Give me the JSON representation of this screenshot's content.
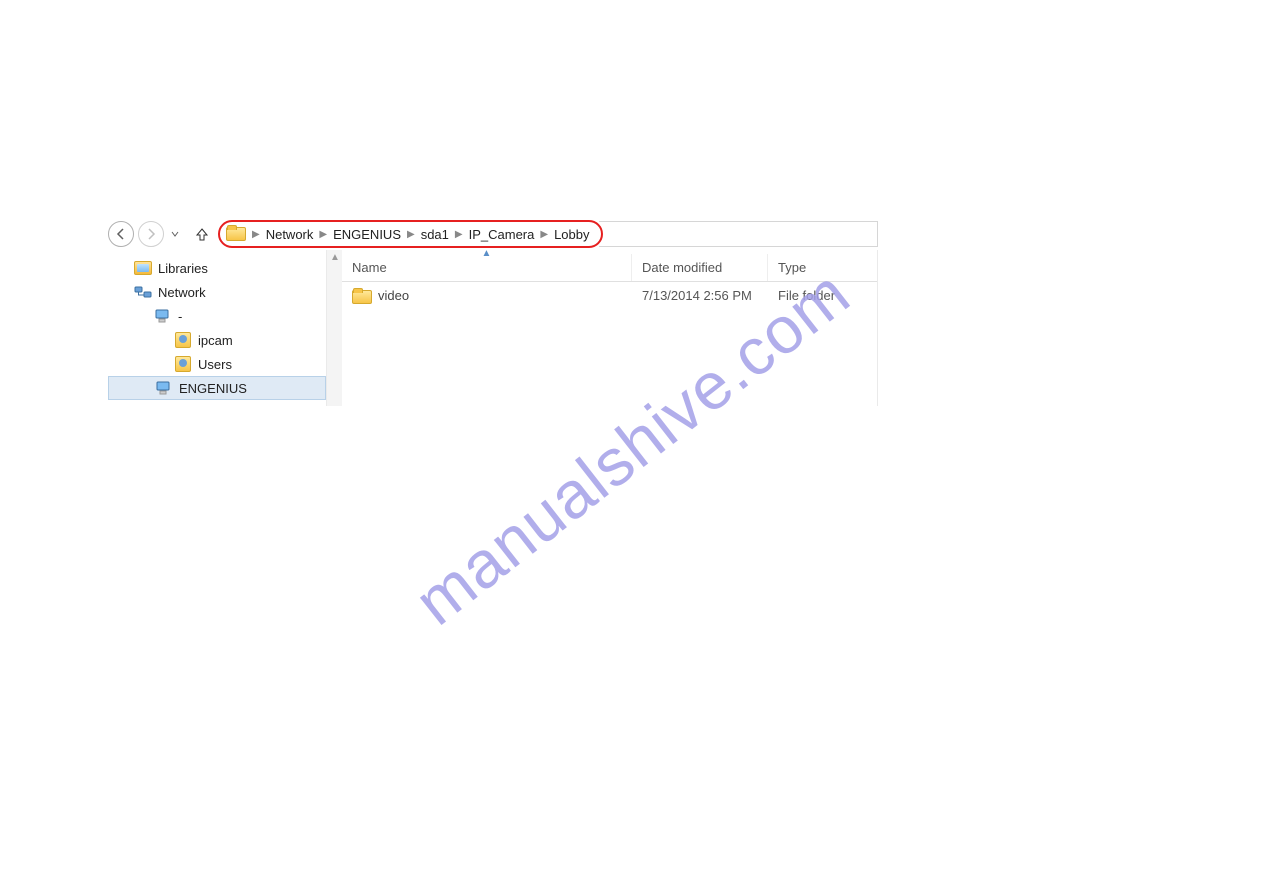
{
  "breadcrumb": [
    "Network",
    "ENGENIUS",
    "sda1",
    "IP_Camera",
    "Lobby"
  ],
  "tree": {
    "libraries": "Libraries",
    "network": "Network",
    "dash": "-",
    "ipcam": "ipcam",
    "users": "Users",
    "engenius": "ENGENIUS"
  },
  "columns": {
    "name": "Name",
    "date": "Date modified",
    "type": "Type"
  },
  "rows": [
    {
      "name": "video",
      "date": "7/13/2014 2:56 PM",
      "type": "File folder"
    }
  ],
  "watermark": "manualshive.com"
}
